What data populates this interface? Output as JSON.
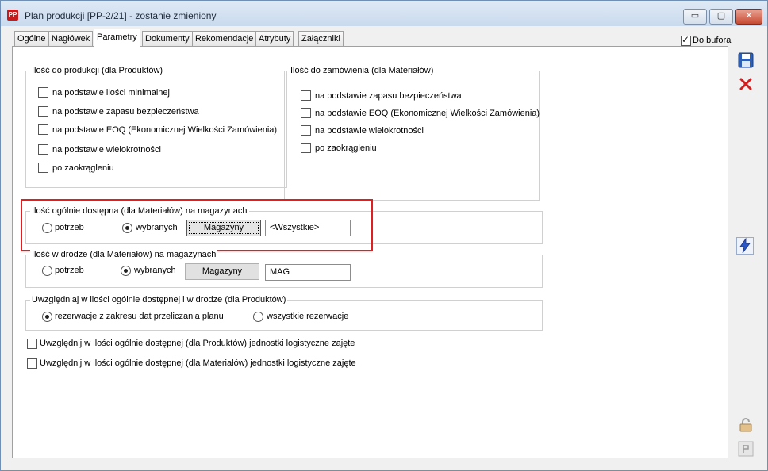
{
  "window": {
    "app_icon": "PP",
    "title": "Plan produkcji [PP-2/21] - zostanie zmieniony",
    "controls": {
      "minimize": "▭",
      "maximize": "▢",
      "close": "✕"
    }
  },
  "tabs": [
    {
      "label": "Ogólne"
    },
    {
      "label": "Nagłówek"
    },
    {
      "label": "Parametry"
    },
    {
      "label": "Dokumenty"
    },
    {
      "label": "Rekomendacje"
    },
    {
      "label": "Atrybuty"
    },
    {
      "label": "Załączniki"
    }
  ],
  "do_bufora": {
    "label": "Do bufora",
    "checked": true
  },
  "ilosc_do_produkcji": {
    "legend": "Ilość do produkcji (dla Produktów)",
    "options": [
      "na podstawie ilości minimalnej",
      "na podstawie zapasu bezpieczeństwa",
      "na podstawie EOQ (Ekonomicznej Wielkości Zamówienia)",
      "na podstawie wielokrotności",
      "po zaokrągleniu"
    ]
  },
  "ilosc_do_zamowienia": {
    "legend": "Ilość do zamówienia (dla Materiałów)",
    "options": [
      "na podstawie zapasu bezpieczeństwa",
      "na podstawie EOQ (Ekonomicznej Wielkości Zamówienia)",
      "na podstawie wielokrotności",
      "po zaokrągleniu"
    ]
  },
  "ilosc_dostepna": {
    "legend": "Ilość ogólnie dostępna (dla Materiałów) na magazynach",
    "radio_potrzeb": "potrzeb",
    "radio_wybranych": "wybranych",
    "selected": "wybranych",
    "button": "Magazyny",
    "value": "<Wszystkie>"
  },
  "ilosc_w_drodze": {
    "legend": "Ilość w drodze (dla Materiałów) na magazynach",
    "radio_potrzeb": "potrzeb",
    "radio_wybranych": "wybranych",
    "selected": "wybranych",
    "button": "Magazyny",
    "value": "MAG"
  },
  "uwzgledniaj": {
    "legend": "Uwzględniaj w ilości ogólnie dostępnej i w drodze (dla Produktów)",
    "radio_zakres": "rezerwacje z zakresu dat przeliczania planu",
    "radio_wszystkie": "wszystkie rezerwacje",
    "selected": "rezerwacje z zakresu dat przeliczania planu"
  },
  "checkboxes": [
    "Uwzględnij w ilości ogólnie dostępnej (dla Produktów) jednostki logistyczne zajęte",
    "Uwzględnij w ilości ogólnie dostępnej (dla Materiałów) jednostki logistyczne zajęte"
  ],
  "side_icons": [
    "save-icon",
    "delete-icon",
    "lightning-icon",
    "lock-icon",
    "pin-icon"
  ],
  "colors": {
    "highlight": "#e02020",
    "save": "#2f5fb3",
    "delete": "#d21e1e",
    "lightning": "#2a56c6"
  }
}
